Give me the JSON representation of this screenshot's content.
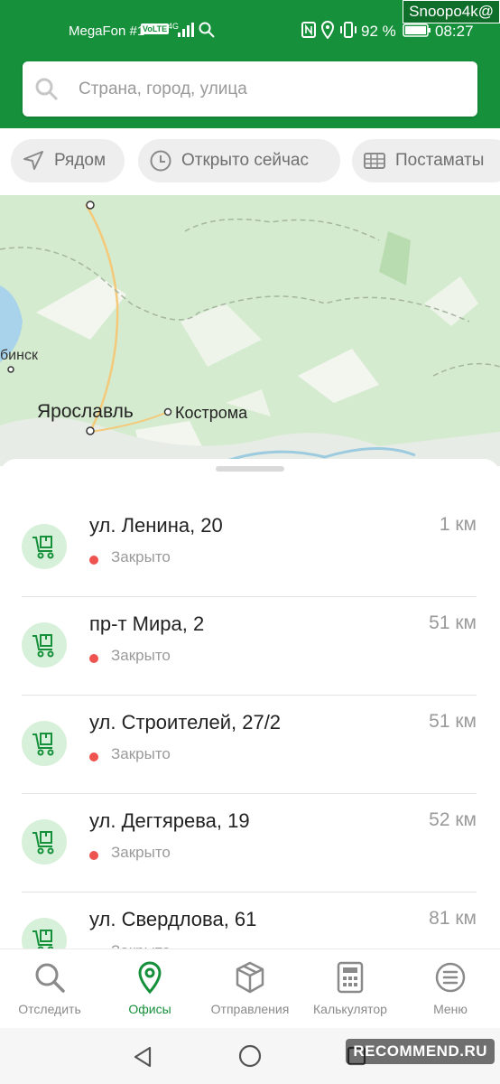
{
  "colors": {
    "brand": "#16903b",
    "closed": "#ef5350",
    "icon_bubble": "#d7f0d9"
  },
  "status_bar": {
    "carrier": "MegaFon #1",
    "volte": "VoLTE",
    "network": "4G",
    "battery": "92 %",
    "time": "08:27",
    "watermark": "Snoopo4k@"
  },
  "search": {
    "placeholder": "Страна, город, улица",
    "icon": "search-icon"
  },
  "chips": [
    {
      "label": "Рядом",
      "icon": "navigation-arrow-icon"
    },
    {
      "label": "Открыто сейчас",
      "icon": "clock-icon"
    },
    {
      "label": "Постаматы",
      "icon": "parcel-locker-icon"
    }
  ],
  "map": {
    "labels": {
      "city1": "Ярославль",
      "city2": "Кострома",
      "city3": "бинск"
    }
  },
  "offices": [
    {
      "address": "ул. Ленина, 20",
      "distance": "1 км",
      "status": "Закрыто"
    },
    {
      "address": "пр-т Мира, 2",
      "distance": "51 км",
      "status": "Закрыто"
    },
    {
      "address": "ул. Строителей, 27/2",
      "distance": "51 км",
      "status": "Закрыто"
    },
    {
      "address": "ул. Дегтярева, 19",
      "distance": "52 км",
      "status": "Закрыто"
    },
    {
      "address": "ул. Свердлова, 61",
      "distance": "81 км",
      "status": "Закрыто"
    }
  ],
  "bottom_nav": [
    {
      "label": "Отследить",
      "icon": "search-icon"
    },
    {
      "label": "Офисы",
      "icon": "location-pin-icon",
      "active": true
    },
    {
      "label": "Отправления",
      "icon": "package-icon"
    },
    {
      "label": "Калькулятор",
      "icon": "calculator-icon"
    },
    {
      "label": "Меню",
      "icon": "menu-icon"
    }
  ],
  "watermark_bottom": "RECOMMEND.RU"
}
